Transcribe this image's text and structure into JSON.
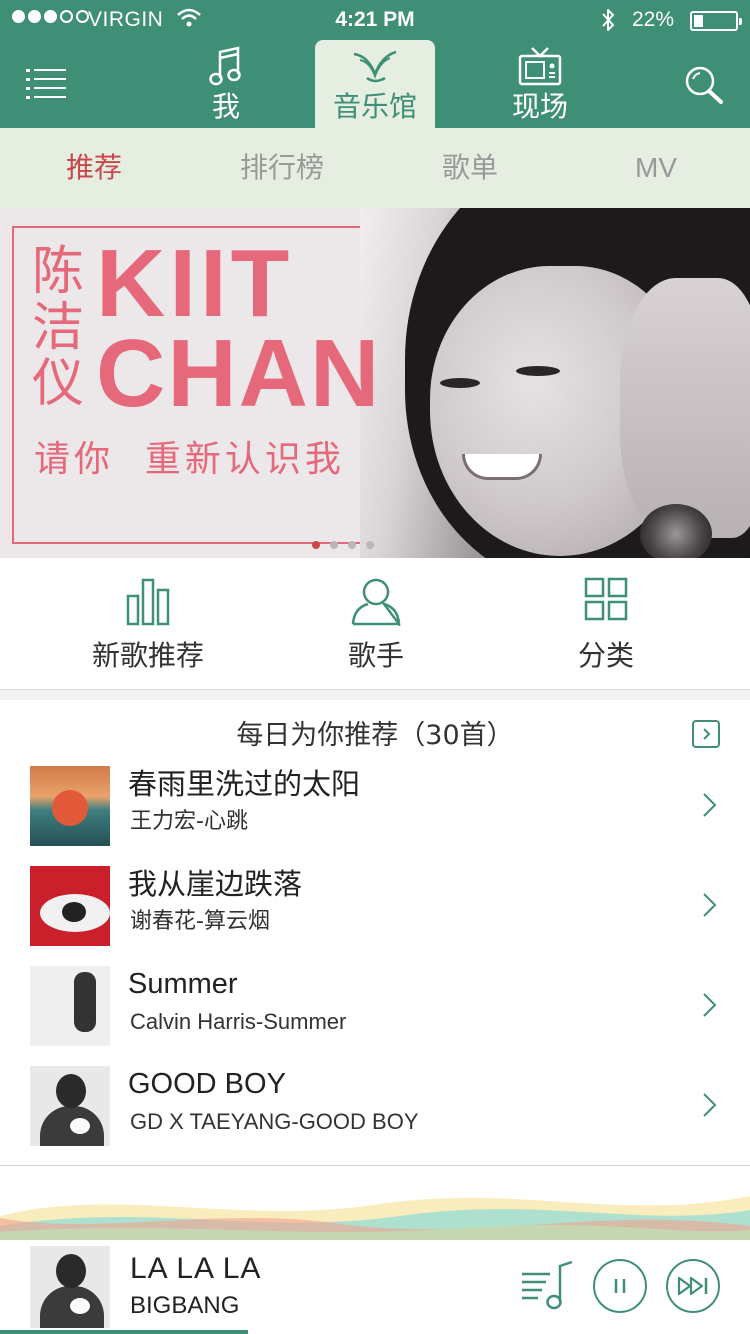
{
  "status_bar": {
    "carrier": "VIRGIN",
    "time": "4:21 PM",
    "battery": "22%",
    "icons": [
      "signal-dots-icon",
      "wifi-icon",
      "bluetooth-icon",
      "battery-icon"
    ]
  },
  "header": {
    "tabs": [
      {
        "label": "我",
        "icon": "music-note-icon"
      },
      {
        "label": "音乐馆",
        "icon": "bird-logo-icon",
        "active": true
      },
      {
        "label": "现场",
        "icon": "tv-icon"
      }
    ],
    "menu_icon": "menu-icon",
    "search_icon": "search-icon"
  },
  "sub_tabs": [
    {
      "label": "推荐",
      "active": true
    },
    {
      "label": "排行榜"
    },
    {
      "label": "歌单"
    },
    {
      "label": "MV"
    }
  ],
  "banner": {
    "name_cn": "陈洁仪",
    "name_en_line1": "KIIT",
    "name_en_line2": "CHAN",
    "tagline": "请你  重新认识我",
    "active_slide": 1
  },
  "quick_entries": [
    {
      "label": "新歌推荐",
      "icon": "bar-chart-icon"
    },
    {
      "label": "歌手",
      "icon": "person-icon"
    },
    {
      "label": "分类",
      "icon": "grid-icon"
    }
  ],
  "daily": {
    "title": "每日为你推荐（30首）",
    "songs": [
      {
        "title": "春雨里洗过的太阳",
        "subtitle": "王力宏-心跳"
      },
      {
        "title": "我从崖边跌落",
        "subtitle": "谢春花-算云烟"
      },
      {
        "title": "Summer",
        "subtitle": "Calvin Harris-Summer"
      },
      {
        "title": "GOOD BOY",
        "subtitle": "GD X TAEYANG-GOOD BOY"
      }
    ]
  },
  "player": {
    "title": "LA LA LA",
    "artist": "BIGBANG",
    "progress": 0.33
  },
  "colors": {
    "primary": "#3f8f77",
    "accent_red": "#c8474a",
    "banner_pink": "#e5697a",
    "subtab_bg": "#e6eee1"
  }
}
